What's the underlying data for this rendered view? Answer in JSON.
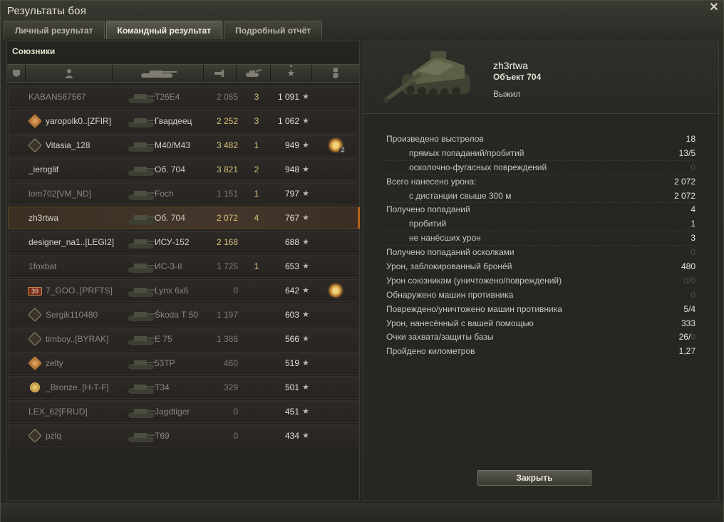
{
  "window": {
    "title": "Результаты боя",
    "close_icon": "close-icon"
  },
  "tabs": [
    {
      "label": "Личный результат",
      "active": false
    },
    {
      "label": "Командный результат",
      "active": true
    },
    {
      "label": "Подробный отчёт",
      "active": false
    }
  ],
  "team": {
    "title": "Союзники",
    "header_icons": [
      "squad-icon",
      "player-icon",
      "tank-icon",
      "damage-icon",
      "kills-icon",
      "xp-star-icon",
      "medal-icon"
    ],
    "rows": [
      {
        "name": "KABAN567567",
        "tank": "T26E4",
        "damage": "2 085",
        "kills": "3",
        "xp": "1 091",
        "dead": true,
        "me": false,
        "badge": "",
        "medal": ""
      },
      {
        "name": "yaropolk0..[ZFIR]",
        "tank": "Гвардеец",
        "damage": "2 252",
        "kills": "3",
        "xp": "1 062",
        "dead": false,
        "me": false,
        "badge": "tank-badge-icon",
        "medal": ""
      },
      {
        "name": "Vitasia_128",
        "tank": "M40/M43",
        "damage": "3 482",
        "kills": "1",
        "xp": "949",
        "dead": false,
        "me": false,
        "badge": "rank-badge-icon",
        "medal": "medal-icon",
        "medal_count": "2"
      },
      {
        "name": "_ieroglif",
        "tank": "Об. 704",
        "damage": "3 821",
        "kills": "2",
        "xp": "948",
        "dead": false,
        "me": false,
        "badge": "",
        "medal": ""
      },
      {
        "name": "lom702[VM_ND]",
        "tank": "Foch",
        "damage": "1 151",
        "kills": "1",
        "xp": "797",
        "dead": true,
        "me": false,
        "badge": "",
        "medal": ""
      },
      {
        "name": "zh3rtwa",
        "tank": "Об. 704",
        "damage": "2 072",
        "kills": "4",
        "xp": "767",
        "dead": false,
        "me": true,
        "badge": "",
        "medal": ""
      },
      {
        "name": "designer_na1..[LEGI2]",
        "tank": "ИСУ-152",
        "damage": "2 168",
        "kills": "",
        "xp": "688",
        "dead": false,
        "me": false,
        "badge": "",
        "medal": ""
      },
      {
        "name": "1foxbat",
        "tank": "ИС-3-II",
        "damage": "1 725",
        "kills": "1",
        "xp": "653",
        "dead": true,
        "me": false,
        "badge": "",
        "medal": ""
      },
      {
        "name": "7_GOO..[PRFTS]",
        "tank": "Lynx 6x6",
        "damage": "0",
        "kills": "",
        "xp": "642",
        "dead": true,
        "me": false,
        "badge": "number-badge-icon",
        "badge_text": "39",
        "medal": "medal-icon"
      },
      {
        "name": "Sergik110480",
        "tank": "Škoda T 50",
        "damage": "1 197",
        "kills": "",
        "xp": "603",
        "dead": true,
        "me": false,
        "badge": "rank-badge-icon",
        "medal": ""
      },
      {
        "name": "timboy..[BYRAK]",
        "tank": "E 75",
        "damage": "1 388",
        "kills": "",
        "xp": "566",
        "dead": true,
        "me": false,
        "badge": "rank-badge-icon",
        "medal": ""
      },
      {
        "name": "zelty",
        "tank": "53TP",
        "damage": "460",
        "kills": "",
        "xp": "519",
        "dead": true,
        "me": false,
        "badge": "wings-badge-icon",
        "medal": ""
      },
      {
        "name": "_Bronze..[H-T-F]",
        "tank": "T34",
        "damage": "329",
        "kills": "",
        "xp": "501",
        "dead": true,
        "me": false,
        "badge": "gold-badge-icon",
        "medal": ""
      },
      {
        "name": "LEX_62[FRUD]",
        "tank": "Jagdtiger",
        "damage": "0",
        "kills": "",
        "xp": "451",
        "dead": true,
        "me": false,
        "badge": "",
        "medal": ""
      },
      {
        "name": "pzlq",
        "tank": "T69",
        "damage": "0",
        "kills": "",
        "xp": "434",
        "dead": true,
        "me": false,
        "badge": "rank-badge-icon",
        "medal": ""
      }
    ]
  },
  "player": {
    "name": "zh3rtwa",
    "tank": "Объект 704",
    "status": "Выжил",
    "close_label": "Закрыть"
  },
  "stats": [
    {
      "label": "Произведено выстрелов",
      "value": "18",
      "indent": false,
      "dim": false
    },
    {
      "label": "прямых попаданий/пробитий",
      "value": "13/5",
      "indent": true,
      "dim": false
    },
    {
      "label": "осколочно-фугасных повреждений",
      "value": "0",
      "indent": true,
      "dim": true
    },
    {
      "label": "Всего нанесено урона:",
      "value": "2 072",
      "indent": false,
      "dim": false
    },
    {
      "label": "с дистанции свыше 300 м",
      "value": "2 072",
      "indent": true,
      "dim": false
    },
    {
      "label": "Получено попаданий",
      "value": "4",
      "indent": false,
      "dim": false
    },
    {
      "label": "пробитий",
      "value": "1",
      "indent": true,
      "dim": false
    },
    {
      "label": "не нанёсших урон",
      "value": "3",
      "indent": true,
      "dim": false
    },
    {
      "label": "Получено попаданий осколками",
      "value": "0",
      "indent": false,
      "dim": true
    },
    {
      "label": "Урон, заблокированный бронёй",
      "value": "480",
      "indent": false,
      "dim": false
    },
    {
      "label": "Урон союзникам (уничтожено/повреждений)",
      "value": "0/0",
      "indent": false,
      "dim": true
    },
    {
      "label": "Обнаружено машин противника",
      "value": "0",
      "indent": false,
      "dim": true
    },
    {
      "label": "Повреждено/уничтожено машин противника",
      "value": "5/4",
      "indent": false,
      "dim": false
    },
    {
      "label": "Урон, нанесённый с вашей помощью",
      "value": "333",
      "indent": false,
      "dim": false
    },
    {
      "label": "Очки захвата/защиты базы",
      "value": "26/",
      "value_dim_part": "0",
      "indent": false,
      "dim": false
    },
    {
      "label": "Пройдено километров",
      "value": "1,27",
      "indent": false,
      "dim": false
    }
  ]
}
